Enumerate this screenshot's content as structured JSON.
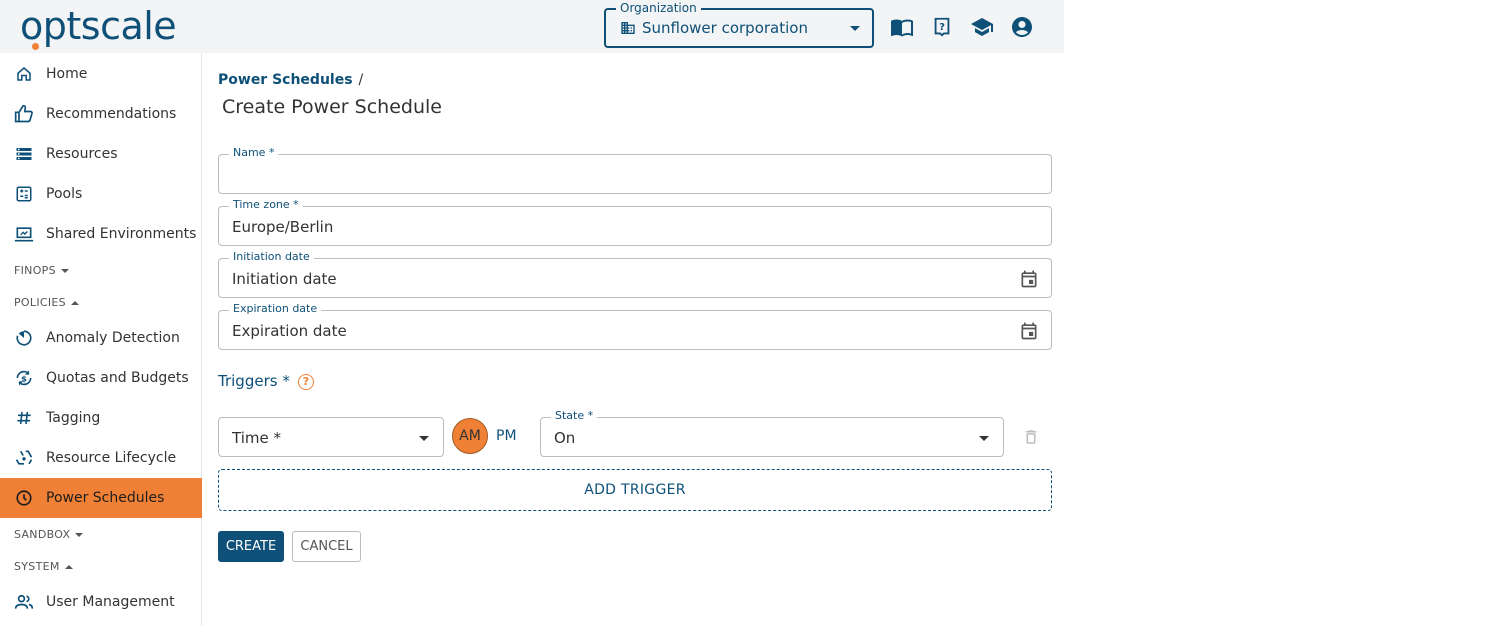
{
  "header": {
    "logo": "optscale",
    "organization_label": "Organization",
    "organization_value": "Sunflower corporation",
    "icons": [
      "book-icon",
      "help-icon",
      "school-icon",
      "account-icon"
    ]
  },
  "sidebar": {
    "items_top": [
      {
        "label": "Home",
        "icon": "home-icon"
      },
      {
        "label": "Recommendations",
        "icon": "thumb-up-icon"
      },
      {
        "label": "Resources",
        "icon": "storage-icon"
      },
      {
        "label": "Pools",
        "icon": "calculator-icon"
      },
      {
        "label": "Shared Environments",
        "icon": "laptop-icon"
      }
    ],
    "section_finops": "FINOPS",
    "section_policies": "POLICIES",
    "items_policies": [
      {
        "label": "Anomaly Detection",
        "icon": "anomaly-icon"
      },
      {
        "label": "Quotas and Budgets",
        "icon": "currency-sync-icon"
      },
      {
        "label": "Tagging",
        "icon": "hash-icon"
      },
      {
        "label": "Resource Lifecycle",
        "icon": "lifecycle-icon"
      },
      {
        "label": "Power Schedules",
        "icon": "clock-icon",
        "active": true
      }
    ],
    "section_sandbox": "SANDBOX",
    "section_system": "SYSTEM",
    "items_system": [
      {
        "label": "User Management",
        "icon": "users-icon"
      }
    ]
  },
  "main": {
    "breadcrumb": "Power Schedules",
    "breadcrumb_sep": "/",
    "title": "Create Power Schedule",
    "form": {
      "name_label": "Name *",
      "name_value": "",
      "timezone_label": "Time zone *",
      "timezone_value": "Europe/Berlin",
      "initiation_label": "Initiation date",
      "initiation_placeholder": "Initiation date",
      "expiration_label": "Expiration date",
      "expiration_placeholder": "Expiration date",
      "triggers_label": "Triggers *",
      "trigger": {
        "time_value": "Time *",
        "am": "AM",
        "pm": "PM",
        "state_label": "State *",
        "state_value": "On"
      },
      "add_trigger": "ADD TRIGGER",
      "create": "CREATE",
      "cancel": "CANCEL"
    }
  },
  "colors": {
    "brand": "#0e5078",
    "accent": "#f08035",
    "header_bg": "#f3f4f5"
  }
}
